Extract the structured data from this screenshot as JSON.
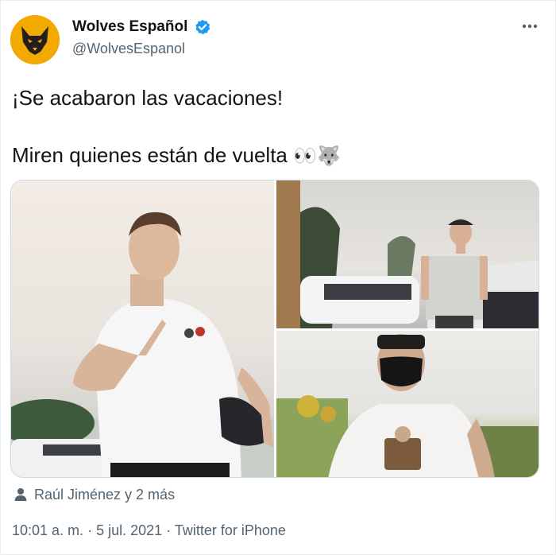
{
  "account": {
    "display_name": "Wolves Español",
    "handle": "@WolvesEspanol",
    "verified": true,
    "avatar_icon": "wolf-head-logo",
    "brand_color": "#f2a900"
  },
  "more_icon": "ellipsis-icon",
  "tweet": {
    "line1": "¡Se acabaron las vacaciones!",
    "line2": "Miren quienes están de vuelta",
    "line2_emoji": "👀🐺"
  },
  "media": {
    "count": 3,
    "photos": [
      {
        "subject": "player-peace-sign"
      },
      {
        "subject": "player-walking-cap"
      },
      {
        "subject": "player-face-mask"
      }
    ]
  },
  "tagged": {
    "icon": "person-icon",
    "text": "Raúl Jiménez y 2 más"
  },
  "meta": {
    "time": "10:01 a. m.",
    "separator": "·",
    "date": "5 jul. 2021",
    "source": "Twitter for iPhone"
  },
  "colors": {
    "text": "#0f1419",
    "secondary": "#536471",
    "verified_blue": "#1d9bf0",
    "border": "#cfd9de"
  }
}
